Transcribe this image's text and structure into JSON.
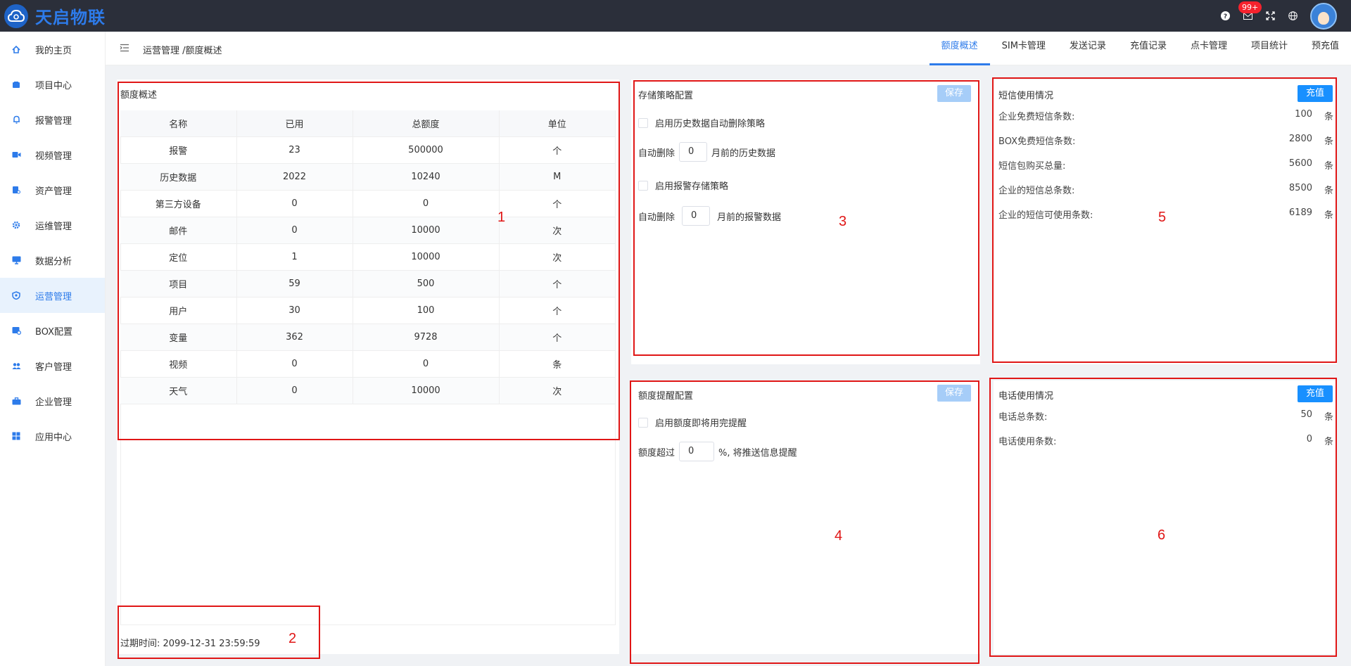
{
  "app": {
    "name": "天启物联"
  },
  "topbar": {
    "badge": "99+"
  },
  "sidebar": {
    "items": [
      {
        "label": "我的主页",
        "icon": "home-icon"
      },
      {
        "label": "项目中心",
        "icon": "folder-icon"
      },
      {
        "label": "报警管理",
        "icon": "bell-icon"
      },
      {
        "label": "视频管理",
        "icon": "video-icon"
      },
      {
        "label": "资产管理",
        "icon": "asset-icon"
      },
      {
        "label": "运维管理",
        "icon": "gear-icon"
      },
      {
        "label": "数据分析",
        "icon": "monitor-icon"
      },
      {
        "label": "运营管理",
        "icon": "shield-icon",
        "active": true
      },
      {
        "label": "BOX配置",
        "icon": "box-icon"
      },
      {
        "label": "客户管理",
        "icon": "users-icon"
      },
      {
        "label": "企业管理",
        "icon": "briefcase-icon"
      },
      {
        "label": "应用中心",
        "icon": "apps-icon"
      }
    ]
  },
  "header": {
    "breadcrumb": "运营管理 /额度概述",
    "tabs": [
      "额度概述",
      "SIM卡管理",
      "发送记录",
      "充值记录",
      "点卡管理",
      "项目统计",
      "预充值"
    ]
  },
  "quota": {
    "title": "额度概述",
    "columns": [
      "名称",
      "已用",
      "总额度",
      "单位"
    ],
    "rows": [
      [
        "报警",
        "23",
        "500000",
        "个"
      ],
      [
        "历史数据",
        "2022",
        "10240",
        "M"
      ],
      [
        "第三方设备",
        "0",
        "0",
        "个"
      ],
      [
        "邮件",
        "0",
        "10000",
        "次"
      ],
      [
        "定位",
        "1",
        "10000",
        "次"
      ],
      [
        "项目",
        "59",
        "500",
        "个"
      ],
      [
        "用户",
        "30",
        "100",
        "个"
      ],
      [
        "变量",
        "362",
        "9728",
        "个"
      ],
      [
        "视频",
        "0",
        "0",
        "条"
      ],
      [
        "天气",
        "0",
        "10000",
        "次"
      ]
    ],
    "expire": "过期时间: 2099-12-31 23:59:59"
  },
  "storage": {
    "title": "存储策略配置",
    "save": "保存",
    "opt1": "启用历史数据自动删除策略",
    "row1_pre": "自动删除",
    "row1_val": "0",
    "row1_post": "月前的历史数据",
    "opt2": "启用报警存储策略",
    "row2_pre": "自动删除",
    "row2_val": "0",
    "row2_post": "月前的报警数据"
  },
  "remind": {
    "title": "额度提醒配置",
    "save": "保存",
    "opt1": "启用额度即将用完提醒",
    "row_pre": "额度超过",
    "row_val": "0",
    "row_post": "%, 将推送信息提醒"
  },
  "sms": {
    "title": "短信使用情况",
    "charge": "充值",
    "rows": [
      {
        "label": "企业免费短信条数:",
        "value": "100",
        "unit": "条"
      },
      {
        "label": "BOX免费短信条数:",
        "value": "2800",
        "unit": "条"
      },
      {
        "label": "短信包购买总量:",
        "value": "5600",
        "unit": "条"
      },
      {
        "label": "企业的短信总条数:",
        "value": "8500",
        "unit": "条"
      },
      {
        "label": "企业的短信可使用条数:",
        "value": "6189",
        "unit": "条"
      }
    ]
  },
  "phone": {
    "title": "电话使用情况",
    "charge": "充值",
    "rows": [
      {
        "label": "电话总条数:",
        "value": "50",
        "unit": "条"
      },
      {
        "label": "电话使用条数:",
        "value": "0",
        "unit": "条"
      }
    ]
  },
  "markers": [
    "1",
    "2",
    "3",
    "4",
    "5",
    "6"
  ],
  "colors": {
    "accent": "#2d7bea",
    "topbar": "#2b2f3a",
    "annotation": "#e01616"
  }
}
